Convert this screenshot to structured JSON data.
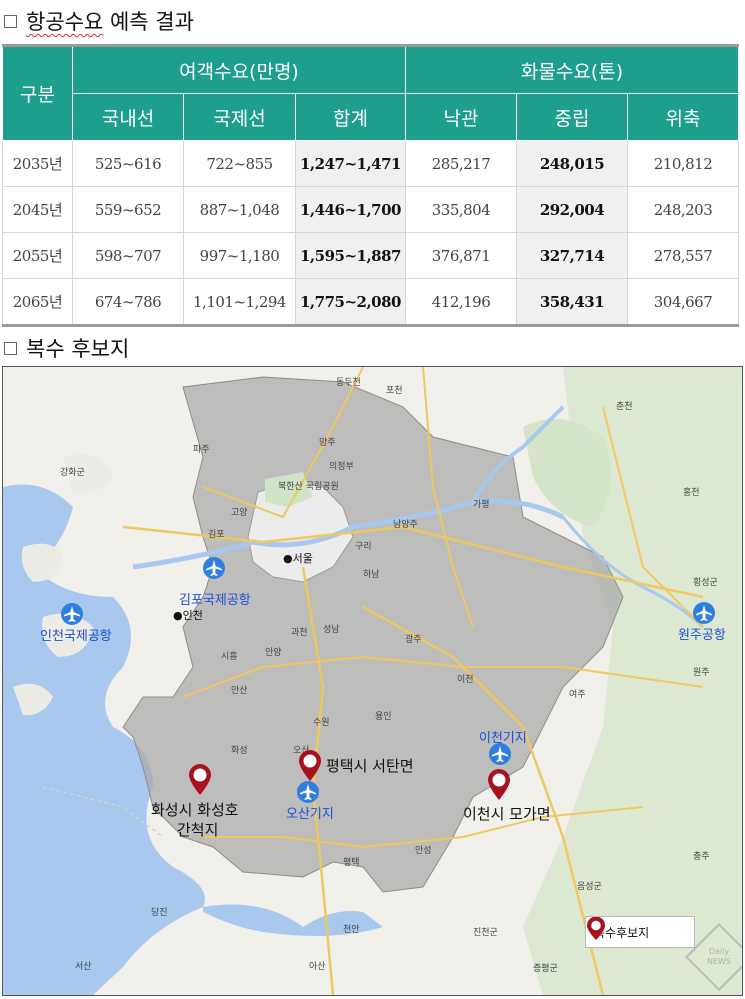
{
  "section1": {
    "title": "항공수요 예측 결과",
    "title_main": "항공수요",
    "title_rest": " 예측 결과"
  },
  "table": {
    "row_header": "구분",
    "group_passenger": "여객수요(만명)",
    "group_cargo": "화물수요(톤)",
    "columns": [
      "국내선",
      "국제선",
      "합계",
      "낙관",
      "중립",
      "위축"
    ],
    "rows": [
      {
        "year": "2035년",
        "cells": [
          "525~616",
          "722~855",
          "1,247~1,471",
          "285,217",
          "248,015",
          "210,812"
        ]
      },
      {
        "year": "2045년",
        "cells": [
          "559~652",
          "887~1,048",
          "1,446~1,700",
          "335,804",
          "292,004",
          "248,203"
        ]
      },
      {
        "year": "2055년",
        "cells": [
          "598~707",
          "997~1,180",
          "1,595~1,887",
          "376,871",
          "327,714",
          "278,557"
        ]
      },
      {
        "year": "2065년",
        "cells": [
          "674~786",
          "1,101~1,294",
          "1,775~2,080",
          "412,196",
          "358,431",
          "304,667"
        ]
      }
    ]
  },
  "section2": {
    "title": "복수 후보지"
  },
  "map": {
    "airports": {
      "gimpo": "김포국제공항",
      "incheon": "인천국제공항",
      "wonju": "원주공항",
      "osan": "오산기지",
      "icheon": "이천기지"
    },
    "candidates": {
      "hwaseong_1": "화성시 화성호",
      "hwaseong_2": "간척지",
      "pyeongtaek": "평택시 서탄면",
      "icheon": "이천시 모가면"
    },
    "cities": {
      "seoul": "서울",
      "incheon_city": "인천",
      "gimpo_city": "김포",
      "goyang": "고양",
      "paju": "파주",
      "yangju": "양주",
      "uijeongbu": "의정부",
      "namyangju": "남양주",
      "hanam": "하남",
      "guri": "구리",
      "seongnam": "성남",
      "anyang": "안양",
      "gwacheon": "과천",
      "siheung": "시흥",
      "ansan": "안산",
      "suwon": "수원",
      "yongin": "용인",
      "gwangju": "광주",
      "icheon_city": "이천",
      "anseong": "안성",
      "pyeongtaek_city": "평택",
      "hwaseong_city": "화성",
      "osan_city": "오산",
      "yeoju": "여주",
      "wonju_city": "원주",
      "chuncheon": "춘천",
      "hongcheon": "홍천",
      "gapyeong": "가평",
      "pocheon": "포천",
      "dongducheon": "동두천",
      "cheonan": "천안",
      "asan": "아산",
      "dangjin": "당진",
      "seosan": "서산",
      "chungju": "충주",
      "ganghwa": "강화군",
      "jincheon": "진천군",
      "eumseong": "음성군",
      "jeungpyeong": "증평군",
      "yanggu": "횡성군",
      "bukhansan": "북한산 국립공원"
    },
    "legend": "복수후보지"
  },
  "watermark": "Daily NEWS",
  "colors": {
    "header_teal": "#1e9e8c",
    "pin_red": "#a8121e",
    "airport_blue": "#2f7fe0",
    "region_gray": "#a9a9a9",
    "sea": "#a8c8ee"
  }
}
